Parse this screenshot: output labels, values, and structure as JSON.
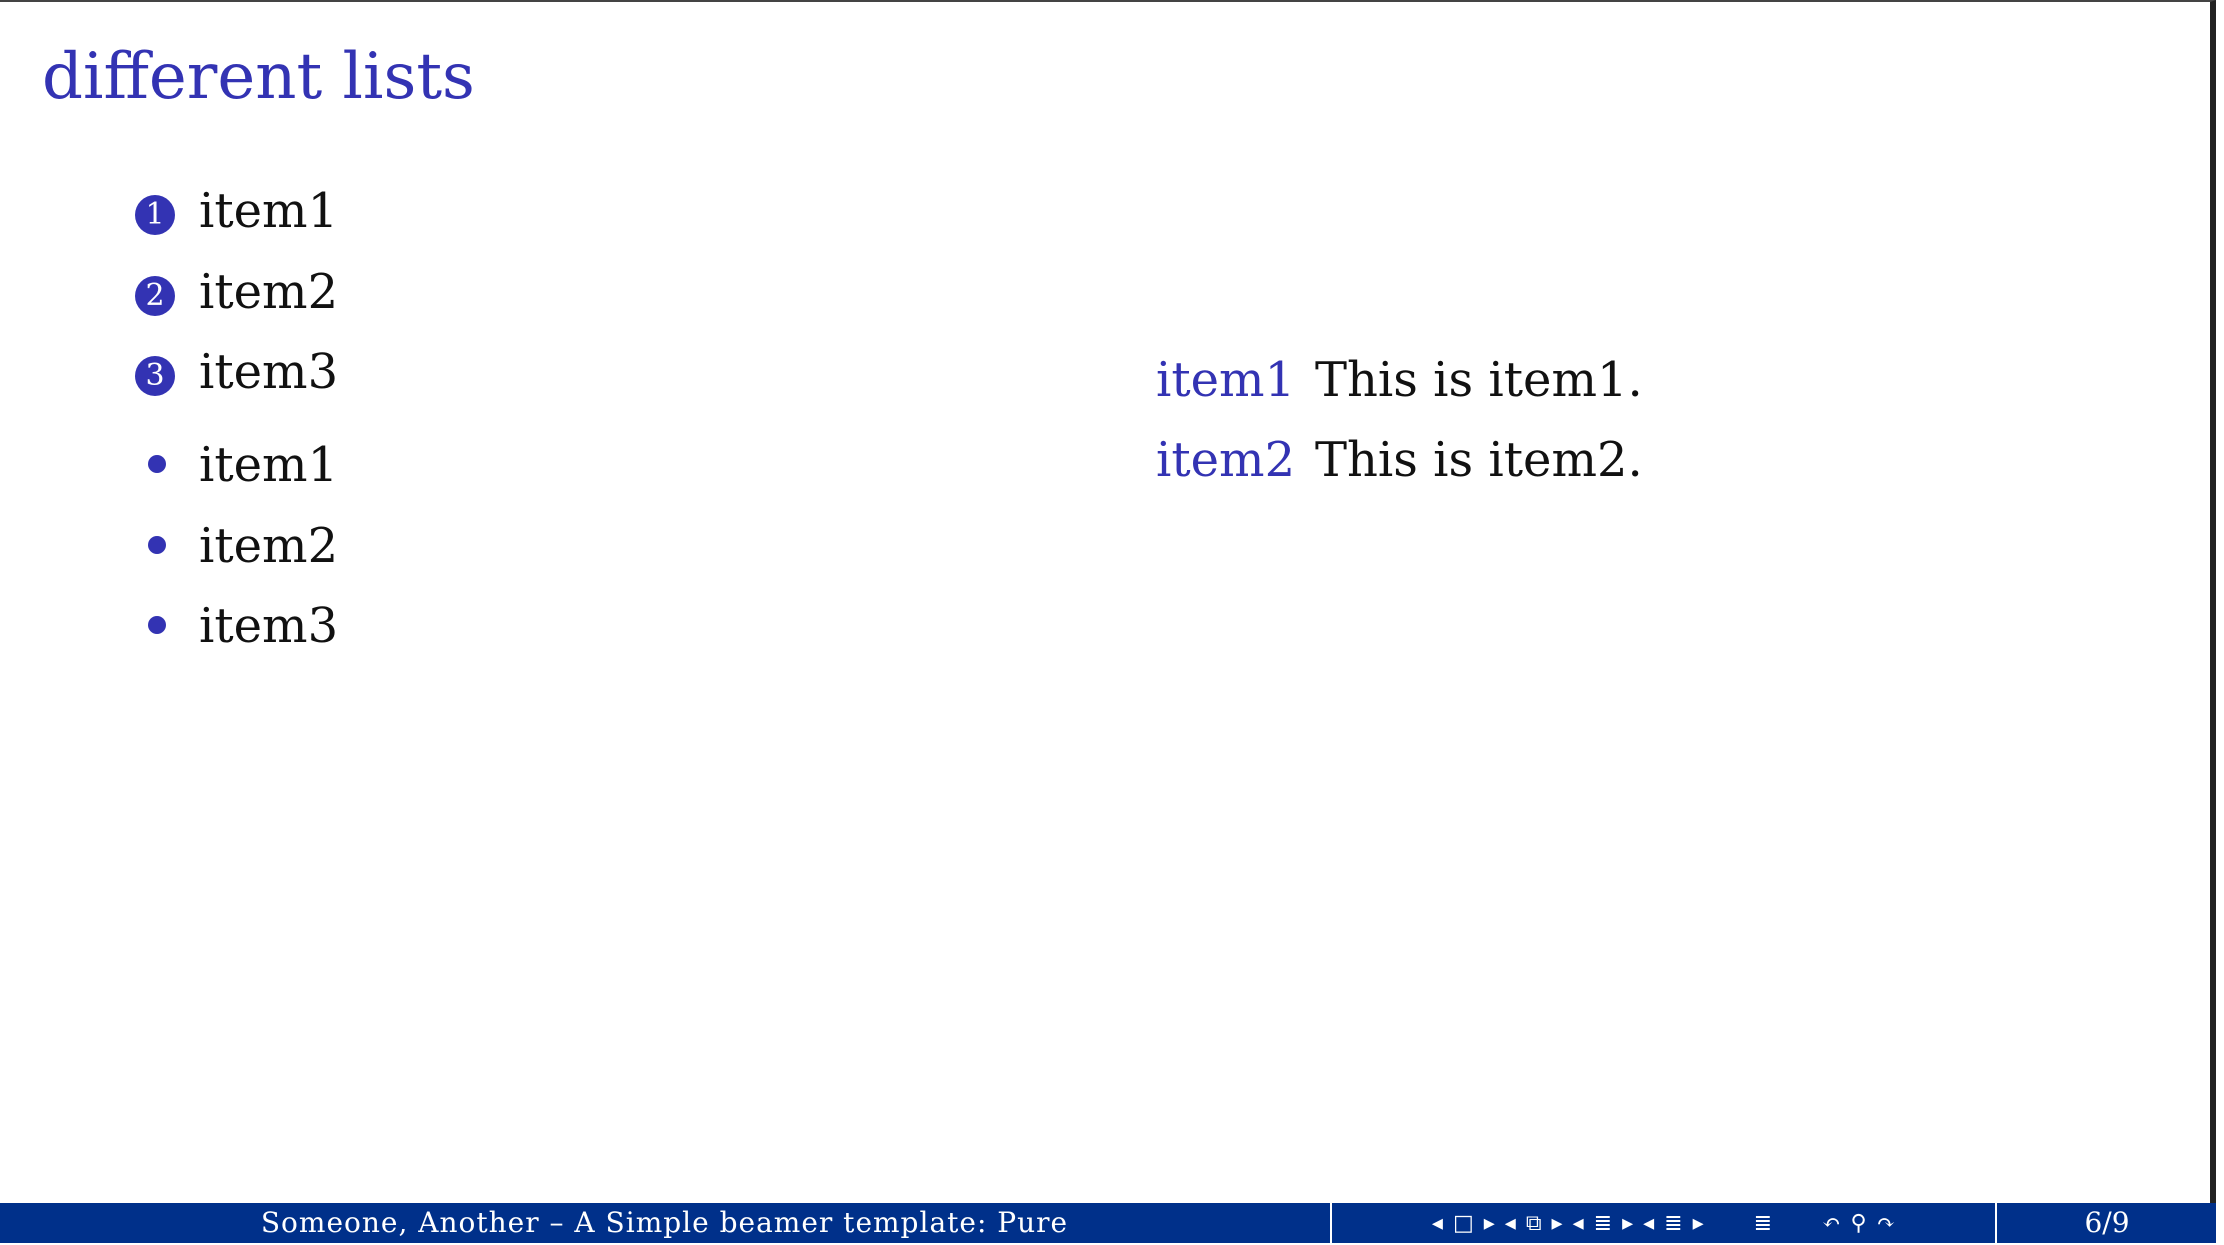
{
  "slide": {
    "title": "different lists",
    "enumerate": [
      {
        "num": "1",
        "label": "item1"
      },
      {
        "num": "2",
        "label": "item2"
      },
      {
        "num": "3",
        "label": "item3"
      }
    ],
    "itemize": [
      "item1",
      "item2",
      "item3"
    ],
    "description": [
      {
        "term": "item1",
        "text": "This is item1."
      },
      {
        "term": "item2",
        "text": "This is item2."
      }
    ]
  },
  "footer": {
    "author_title": "Someone, Another  –  A Simple beamer template: Pure",
    "page": "6/9",
    "nav_icons": [
      "prev-icon",
      "frame-icon",
      "next-icon",
      "prev-icon",
      "subsection-icon",
      "next-icon",
      "prev-icon",
      "section-icon",
      "next-icon",
      "prev-icon",
      "presentation-icon",
      "next-icon",
      "toc-icon",
      "undo-icon",
      "search-icon",
      "redo-icon"
    ]
  },
  "colors": {
    "accent": "#3333b3",
    "footer_bg": "#00308a"
  }
}
